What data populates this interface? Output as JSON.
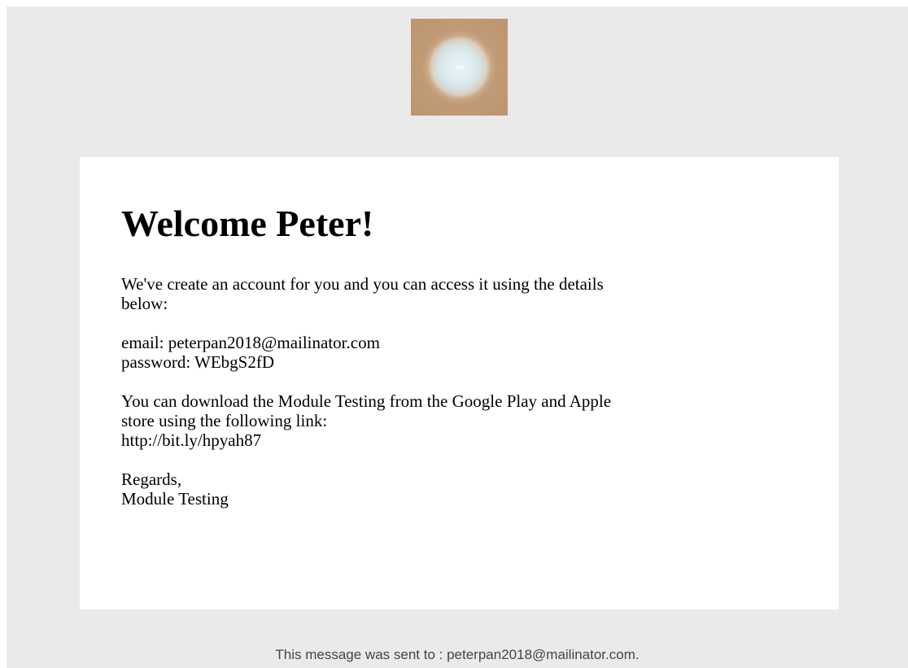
{
  "logo": {
    "icon": "app-logo-icon",
    "colors": {
      "outer": "#bd9570",
      "inner": "#e8f4f8"
    }
  },
  "email": {
    "heading": "Welcome Peter!",
    "intro_lines": [
      "We've create an account for you and you can access it using the details",
      "below:"
    ],
    "credentials": {
      "email_line": "email: peterpan2018@mailinator.com",
      "password_line": "password: WEbgS2fD"
    },
    "download_lines": [
      "You can download the Module Testing from the Google Play and Apple",
      "store using the following link:"
    ],
    "link": "http://bit.ly/hpyah87",
    "signoff": {
      "regards": "Regards,",
      "sender": "Module Testing"
    }
  },
  "footer": {
    "text": "This message was sent to : peterpan2018@mailinator.com."
  },
  "colors": {
    "background": "#eaeaea",
    "card": "#ffffff",
    "text": "#000000",
    "footer_text": "#444444"
  }
}
